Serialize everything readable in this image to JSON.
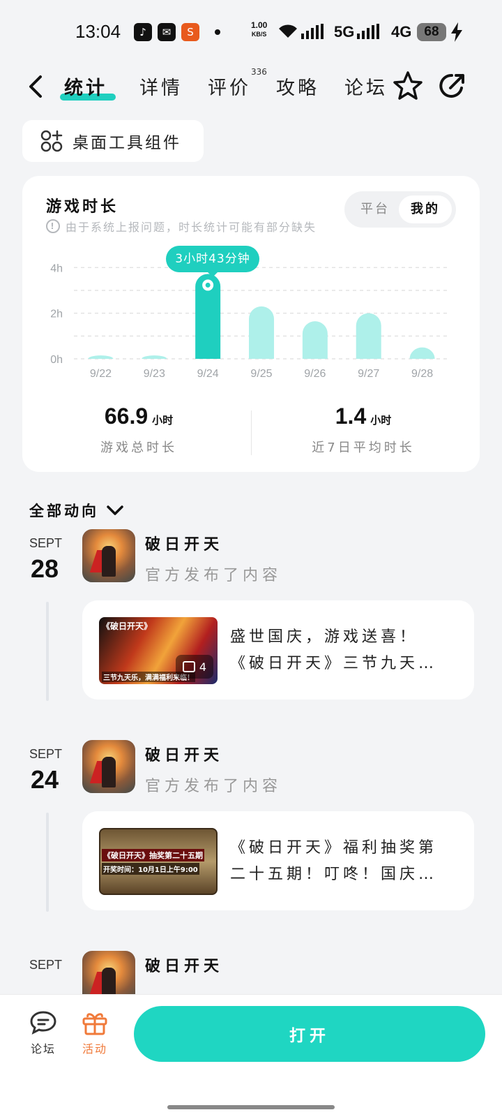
{
  "status_bar": {
    "time": "13:04",
    "net_speed_value": "1.00",
    "net_speed_unit": "KB/S",
    "network_1": "5G",
    "network_2": "4G",
    "battery": "68",
    "app_icons": [
      "tiktok-icon",
      "mail-icon",
      "sina-icon"
    ]
  },
  "nav": {
    "tabs": [
      {
        "label": "统计",
        "active": true
      },
      {
        "label": "详情",
        "active": false
      },
      {
        "label": "评价",
        "active": false,
        "badge": "336"
      },
      {
        "label": "攻略",
        "active": false
      },
      {
        "label": "论坛",
        "active": false
      }
    ]
  },
  "widget_button": {
    "label": "桌面工具组件"
  },
  "stats_card": {
    "title": "游戏时长",
    "note": "由于系统上报问题，时长统计可能有部分缺失",
    "toggle": {
      "options": [
        "平台",
        "我的"
      ],
      "selected": "我的"
    },
    "tooltip": "3小时43分钟",
    "total": {
      "value": "66.9",
      "unit": "小时",
      "label": "游戏总时长"
    },
    "average": {
      "value": "1.4",
      "unit": "小时",
      "label": "近7日平均时长"
    }
  },
  "chart_data": {
    "type": "bar",
    "categories": [
      "9/22",
      "9/23",
      "9/24",
      "9/25",
      "9/26",
      "9/27",
      "9/28"
    ],
    "values": [
      0.15,
      0.15,
      3.72,
      2.3,
      1.65,
      2.0,
      0.5
    ],
    "y_ticks": [
      "0h",
      "2h",
      "4h"
    ],
    "ylim": [
      0,
      4.1
    ],
    "highlighted_index": 2,
    "colors": {
      "highlight": "#1fcfbf",
      "normal": "#aef0ea"
    },
    "grid": true
  },
  "feed": {
    "filter_label": "全部动向",
    "items": [
      {
        "month": "SEPT",
        "day": "28",
        "name": "破日开天",
        "subtitle": "官方发布了内容",
        "text": "盛世国庆，游戏送喜！《破日开天》三节九天…",
        "thumb_title": "《破日开天》",
        "thumb_caption": "三节九天乐，满满福利来临！",
        "image_count": "4"
      },
      {
        "month": "SEPT",
        "day": "24",
        "name": "破日开天",
        "subtitle": "官方发布了内容",
        "text": "《破日开天》福利抽奖第二十五期！叮咚！国庆…",
        "thumb_title": "《破日开天》抽奖第二十五期",
        "thumb_caption": "开奖时间：10月1日上午9:00"
      },
      {
        "month": "SEPT",
        "name": "破日开天"
      }
    ]
  },
  "bottom_bar": {
    "forum_label": "论坛",
    "events_label": "活动",
    "open_label": "打开",
    "accent": "#1fd6c2",
    "events_color": "#f07a3a"
  }
}
